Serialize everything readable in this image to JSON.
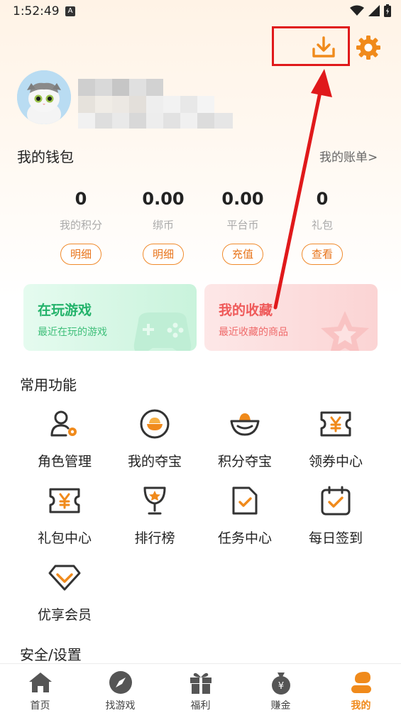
{
  "status_bar": {
    "time": "1:52:49",
    "notif": "A"
  },
  "wallet": {
    "title": "我的钱包",
    "bill_link": "我的账单>",
    "stats": [
      {
        "value": "0",
        "label": "我的积分",
        "button": "明细"
      },
      {
        "value": "0.00",
        "label": "绑币",
        "button": "明细"
      },
      {
        "value": "0.00",
        "label": "平台币",
        "button": "充值"
      },
      {
        "value": "0",
        "label": "礼包",
        "button": "查看"
      }
    ]
  },
  "cards": {
    "playing": {
      "title": "在玩游戏",
      "subtitle": "最近在玩的游戏",
      "title_color": "#23b26a",
      "sub_color": "#3fbf7a"
    },
    "favorites": {
      "title": "我的收藏",
      "subtitle": "最近收藏的商品",
      "title_color": "#ef5a5a",
      "sub_color": "#ef6a6a"
    }
  },
  "functions": {
    "title": "常用功能",
    "items": [
      {
        "label": "角色管理",
        "icon": "role-manage-icon"
      },
      {
        "label": "我的夺宝",
        "icon": "my-treasure-icon"
      },
      {
        "label": "积分夺宝",
        "icon": "points-treasure-icon"
      },
      {
        "label": "领券中心",
        "icon": "coupon-icon"
      },
      {
        "label": "礼包中心",
        "icon": "gift-pack-icon"
      },
      {
        "label": "排行榜",
        "icon": "trophy-icon"
      },
      {
        "label": "任务中心",
        "icon": "task-icon"
      },
      {
        "label": "每日签到",
        "icon": "checkin-icon"
      },
      {
        "label": "优享会员",
        "icon": "vip-icon"
      }
    ]
  },
  "security": {
    "title": "安全/设置"
  },
  "nav": {
    "items": [
      {
        "label": "首页",
        "icon": "home-icon"
      },
      {
        "label": "找游戏",
        "icon": "compass-icon"
      },
      {
        "label": "福利",
        "icon": "gift-icon"
      },
      {
        "label": "赚金",
        "icon": "money-bag-icon"
      },
      {
        "label": "我的",
        "icon": "user-icon"
      }
    ],
    "active_index": 4
  },
  "colors": {
    "accent": "#f08a1b",
    "highlight": "#e0191b"
  }
}
